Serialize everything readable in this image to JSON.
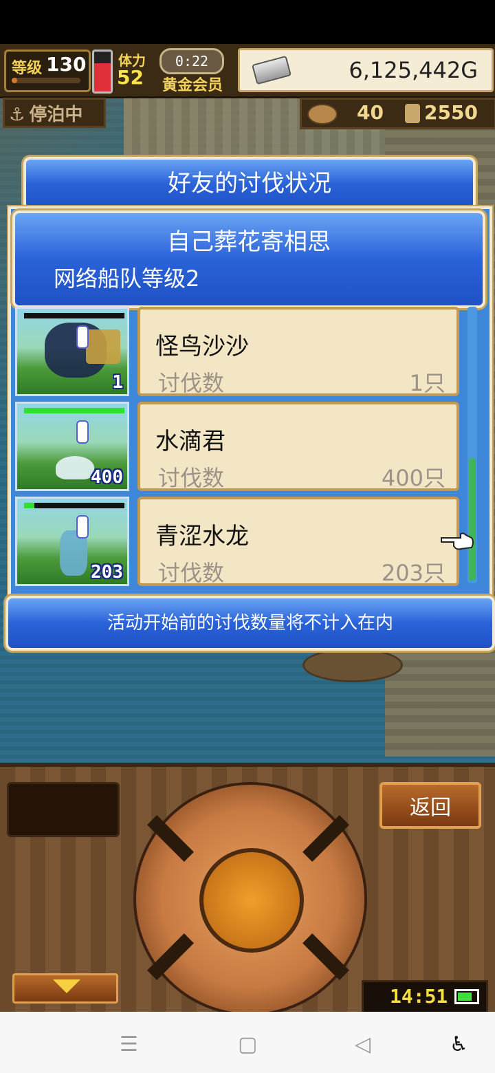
{
  "hud": {
    "level_label": "等级",
    "level_value": "130",
    "level_progress_fraction": 0.08,
    "stamina_label": "体力",
    "stamina_value": "52",
    "stamina_fraction": 0.7,
    "timer": "0:22",
    "member_label": "黄金会员",
    "money": "6,125,442G",
    "docked_label": "停泊中",
    "resource_a": "40",
    "resource_b": "2550"
  },
  "dialog": {
    "title": "好友的讨伐状况",
    "friend_name": "自己葬花寄相思",
    "fleet_level": "网络船队等级2",
    "kill_label": "讨伐数",
    "entries": [
      {
        "name": "怪鸟沙沙",
        "kills": "1只",
        "thumb_count": "1",
        "hp_fraction": 0.0
      },
      {
        "name": "水滴君",
        "kills": "400只",
        "thumb_count": "400",
        "hp_fraction": 1.0
      },
      {
        "name": "青涩水龙",
        "kills": "203只",
        "thumb_count": "203",
        "hp_fraction": 0.1
      }
    ],
    "notice": "活动开始前的讨伐数量将不计入在内"
  },
  "controls": {
    "back_label": "返回",
    "clock": "14:51",
    "battery_fraction": 0.75
  },
  "icons": [
    "anchor-icon",
    "silver-bar-icon",
    "bolt-icon",
    "coin-icon",
    "pointer-hand-icon",
    "down-arrow-icon",
    "battery-icon",
    "menu-icon",
    "home-icon",
    "back-icon",
    "accessibility-icon"
  ]
}
